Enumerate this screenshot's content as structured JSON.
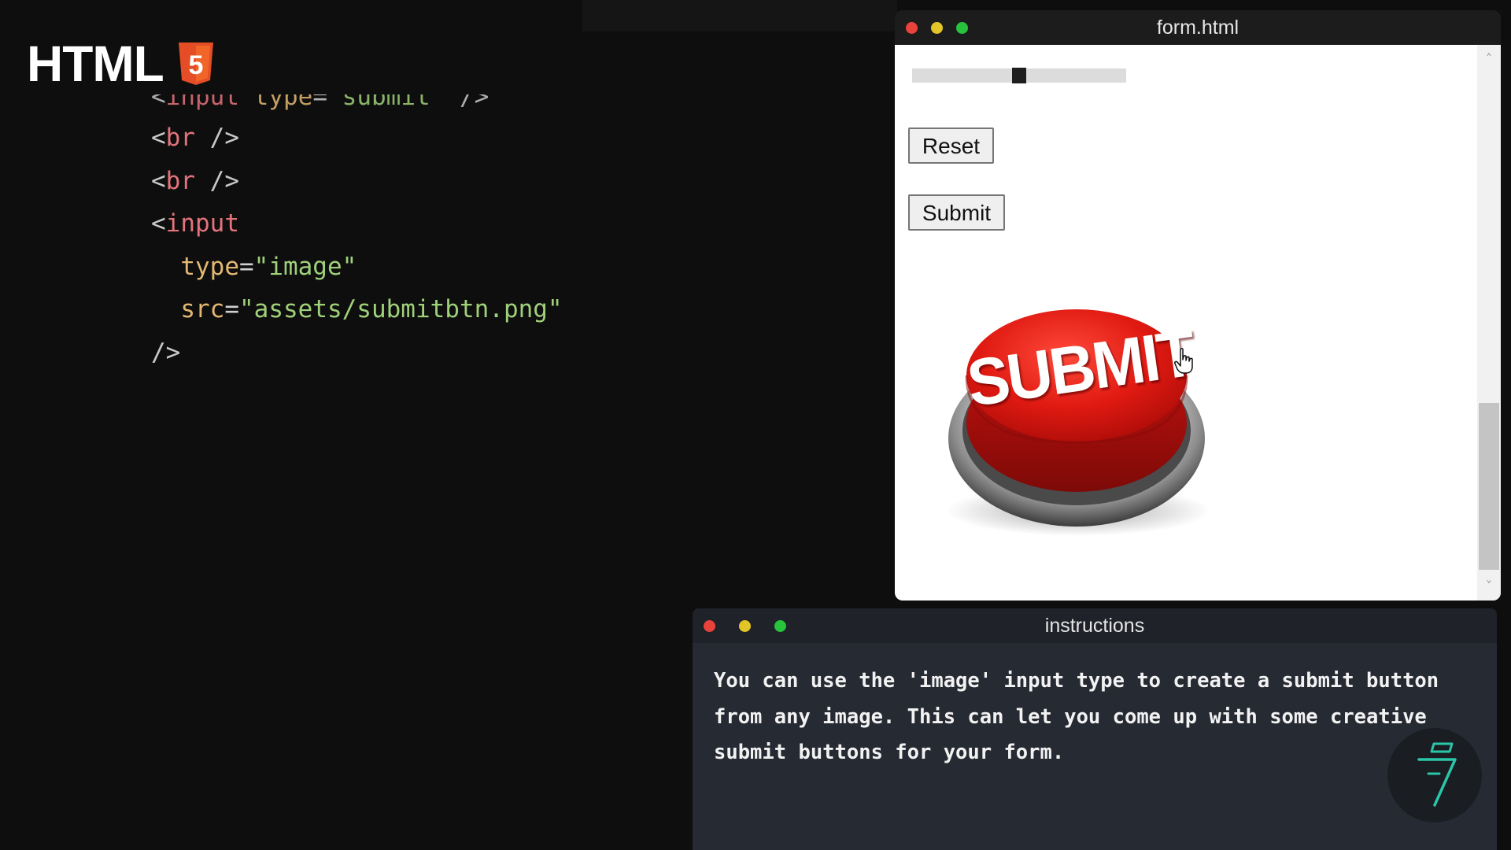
{
  "logo": {
    "text": "HTML",
    "badge_icon": "html5-shield-icon",
    "badge_glyph": "5",
    "color": "#e44d26"
  },
  "code": {
    "lines": [
      [
        {
          "t": "<",
          "c": "punc"
        },
        {
          "t": "input",
          "c": "tag"
        },
        {
          "t": " type",
          "c": "attr"
        },
        {
          "t": "=",
          "c": "eq"
        },
        {
          "t": "\"submit\"",
          "c": "str"
        },
        {
          "t": " />",
          "c": "punc"
        }
      ],
      [
        {
          "t": "<",
          "c": "punc"
        },
        {
          "t": "br",
          "c": "tag"
        },
        {
          "t": " />",
          "c": "punc"
        }
      ],
      [
        {
          "t": "<",
          "c": "punc"
        },
        {
          "t": "br",
          "c": "tag"
        },
        {
          "t": " />",
          "c": "punc"
        }
      ],
      [
        {
          "t": "<",
          "c": "punc"
        },
        {
          "t": "input",
          "c": "tag"
        }
      ],
      [
        {
          "t": "  type",
          "c": "attr"
        },
        {
          "t": "=",
          "c": "eq"
        },
        {
          "t": "\"image\"",
          "c": "str"
        }
      ],
      [
        {
          "t": "  src",
          "c": "attr"
        },
        {
          "t": "=",
          "c": "eq"
        },
        {
          "t": "\"assets/submitbtn.png\"",
          "c": "str"
        }
      ],
      [
        {
          "t": "/>",
          "c": "punc"
        }
      ]
    ],
    "colors": {
      "punc": "#c8c8c8",
      "tag": "#e5737c",
      "attr": "#e2b872",
      "str": "#9fd07a"
    }
  },
  "browser": {
    "title": "form.html",
    "range": {
      "value": 0.5
    },
    "reset_label": "Reset",
    "submit_label": "Submit",
    "image_submit_label": "SUBMIT",
    "image_submit_alt": "submit-image-button",
    "scroll": {
      "up_icon": "chevron-up-icon",
      "down_icon": "chevron-down-icon",
      "up_glyph": "˄",
      "down_glyph": "˅"
    }
  },
  "instructions": {
    "title": "instructions",
    "lines": [
      "You can use the 'image' input type to create a submit button",
      "from any image. This can let you come up with some creative",
      "submit buttons for your form."
    ]
  },
  "window_controls": {
    "close_color": "#e8433a",
    "minimize_color": "#e2c526",
    "maximize_color": "#27c33d"
  },
  "brand_badge": {
    "icon": "lightning-bolt-icon",
    "color": "#2bc6a8"
  }
}
